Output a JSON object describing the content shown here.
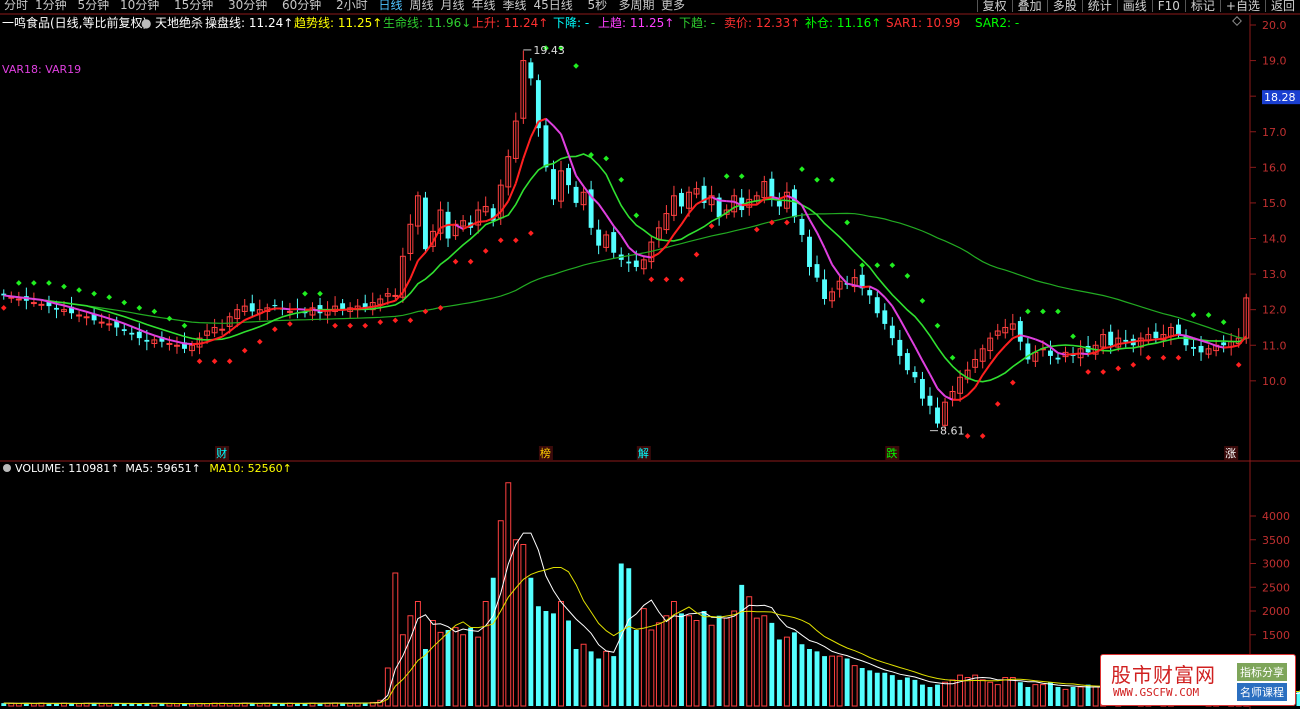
{
  "toolbar": {
    "tabs": [
      "分时",
      "1分钟",
      "5分钟",
      "10分钟",
      "15分钟",
      "30分钟",
      "60分钟",
      "2小时",
      "日线",
      "周线",
      "月线",
      "年线",
      "季线",
      "45日线",
      "5秒",
      "多周期",
      "更多"
    ],
    "active_tab": "日线",
    "right_buttons": [
      "复权",
      "叠加",
      "多股",
      "统计",
      "画线",
      "F10",
      "标记",
      "+自选",
      "返回"
    ]
  },
  "info": {
    "stock": "一鸣食品(日线,等比前复权)",
    "indicator_icon": "circle-chevron-icon",
    "indicator": "天地绝杀",
    "items": [
      {
        "label": "操盘线: ",
        "value": "11.24",
        "arrow": "↑",
        "color": "#ffffff"
      },
      {
        "label": "趋势线: ",
        "value": "11.25",
        "arrow": "↑",
        "color": "#ffff00"
      },
      {
        "label": "生命线: ",
        "value": "11.96",
        "arrow": "↓",
        "color": "#2ecc2e"
      },
      {
        "label": "上升: ",
        "value": "11.24",
        "arrow": "↑",
        "color": "#ff3030"
      },
      {
        "label": "下降: ",
        "value": "-",
        "arrow": "",
        "color": "#00ffff"
      },
      {
        "label": "上趋: ",
        "value": "11.25",
        "arrow": "↑",
        "color": "#ff40ff"
      },
      {
        "label": "下趋: ",
        "value": "-",
        "arrow": "",
        "color": "#2ecc2e"
      },
      {
        "label": "卖价: ",
        "value": "12.33",
        "arrow": "↑",
        "color": "#ff3030"
      },
      {
        "label": "补仓: ",
        "value": "11.16",
        "arrow": "↑",
        "color": "#00ff00"
      },
      {
        "label": "SAR1: ",
        "value": "10.99",
        "arrow": "",
        "color": "#ff3030"
      },
      {
        "label": "SAR2: ",
        "value": "-",
        "arrow": "",
        "color": "#00ff00"
      }
    ]
  },
  "var_label": "VAR18: VAR19",
  "volume_info": [
    {
      "label": "VOLUME: ",
      "value": "110981",
      "arrow": "↑",
      "color": "#ffffff"
    },
    {
      "label": "MA5: ",
      "value": "59651",
      "arrow": "↑",
      "color": "#ffffff"
    },
    {
      "label": "MA10: ",
      "value": "52560",
      "arrow": "↑",
      "color": "#ffff00"
    }
  ],
  "price_axis": {
    "min": 8.0,
    "max": 20.0,
    "ticks": [
      10.0,
      11.0,
      12.0,
      13.0,
      14.0,
      15.0,
      16.0,
      17.0,
      18.0,
      19.0,
      20.0
    ],
    "current": "18.28"
  },
  "volume_axis": {
    "ticks": [
      1500,
      2000,
      2500,
      3000,
      3500,
      4000
    ]
  },
  "annotations": {
    "high": "19.43",
    "low": "8.61"
  },
  "signal_labels": [
    {
      "text": "财",
      "index": 29,
      "color": "#00ffff"
    },
    {
      "text": "榜",
      "index": 72,
      "color": "#ffd000"
    },
    {
      "text": "解",
      "index": 85,
      "color": "#00ffff"
    },
    {
      "text": "跌",
      "index": 118,
      "color": "#00ff00"
    },
    {
      "text": "涨",
      "index": 163,
      "color": "#ffffff"
    }
  ],
  "logo": {
    "name": "股市财富网",
    "url": "WWW.GSCFW.COM",
    "tag1": "指标分享",
    "tag2": "名师课程"
  },
  "colors": {
    "up": "#ff4040",
    "down": "#54ffff",
    "ma_long": "#22aa22",
    "trend": "#ff2020",
    "support": "#e040e0",
    "life": "#30e030",
    "sar_up": "#ff2020",
    "sar_down": "#20ee20"
  },
  "chart_data": {
    "type": "candlestick",
    "title": "一鸣食品(日线,等比前复权)",
    "price_range": [
      8.0,
      20.0
    ],
    "close": [
      12.4,
      12.35,
      12.3,
      12.25,
      12.2,
      12.15,
      12.1,
      12.0,
      12.0,
      11.9,
      11.85,
      11.8,
      11.7,
      11.65,
      11.6,
      11.5,
      11.4,
      11.3,
      11.2,
      11.1,
      11.15,
      11.1,
      11.05,
      11.0,
      10.9,
      11.0,
      11.2,
      11.4,
      11.5,
      11.45,
      11.8,
      12.0,
      12.1,
      11.95,
      12.0,
      12.05,
      12.1,
      12.0,
      11.95,
      12.0,
      11.9,
      12.05,
      11.9,
      12.0,
      12.1,
      12.0,
      12.05,
      12.1,
      12.05,
      12.2,
      12.3,
      12.45,
      12.4,
      13.5,
      14.4,
      15.2,
      13.7,
      14.2,
      14.8,
      14.0,
      14.4,
      14.5,
      14.3,
      14.8,
      14.9,
      14.5,
      15.5,
      16.3,
      17.3,
      19.0,
      18.5,
      17.1,
      16.0,
      15.1,
      15.9,
      15.5,
      15.0,
      15.3,
      14.3,
      13.8,
      14.1,
      13.6,
      13.4,
      13.3,
      13.2,
      13.4,
      13.9,
      14.3,
      14.7,
      15.2,
      14.9,
      15.3,
      15.4,
      15.0,
      15.2,
      14.6,
      14.8,
      15.2,
      14.8,
      15.1,
      15.2,
      15.6,
      15.1,
      14.9,
      15.3,
      14.6,
      14.1,
      13.2,
      12.9,
      12.3,
      12.5,
      12.8,
      12.7,
      12.9,
      12.6,
      12.4,
      11.9,
      11.6,
      11.2,
      10.7,
      10.3,
      10.1,
      9.5,
      9.3,
      8.8,
      9.4,
      9.7,
      10.1,
      10.3,
      10.6,
      10.9,
      11.2,
      11.4,
      11.5,
      11.6,
      11.1,
      10.6,
      10.8,
      10.9,
      10.7,
      10.6,
      10.8,
      10.7,
      10.9,
      10.8,
      11.0,
      11.3,
      11.0,
      11.2,
      11.1,
      11.0,
      11.2,
      11.3,
      11.2,
      11.3,
      11.5,
      11.3,
      11.0,
      10.9,
      10.8,
      10.9,
      11.0,
      11.0,
      11.1,
      11.2,
      12.33
    ],
    "volume": [
      60,
      55,
      52,
      58,
      50,
      62,
      48,
      55,
      60,
      52,
      50,
      58,
      60,
      55,
      53,
      50,
      48,
      52,
      55,
      60,
      58,
      52,
      50,
      48,
      46,
      50,
      55,
      52,
      60,
      58,
      52,
      56,
      60,
      55,
      52,
      58,
      50,
      55,
      60,
      52,
      58,
      62,
      55,
      60,
      65,
      58,
      60,
      62,
      70,
      75,
      120,
      800,
      2800,
      1500,
      1900,
      2200,
      1200,
      1800,
      1550,
      1600,
      1650,
      1500,
      1650,
      1450,
      2200,
      2700,
      3900,
      4700,
      3500,
      3400,
      2700,
      2100,
      2000,
      1950,
      2200,
      1800,
      1200,
      1300,
      1150,
      1000,
      1150,
      1050,
      3000,
      2900,
      1600,
      2050,
      1600,
      1750,
      1900,
      2200,
      1950,
      1900,
      1800,
      2000,
      1700,
      1900,
      1850,
      2000,
      2550,
      2300,
      1850,
      1900,
      1750,
      1400,
      1450,
      1550,
      1300,
      1200,
      1150,
      1050,
      1050,
      1050,
      1000,
      850,
      800,
      750,
      700,
      700,
      650,
      550,
      600,
      550,
      450,
      400,
      450,
      500,
      550,
      650,
      600,
      650,
      550,
      500,
      450,
      600,
      600,
      500,
      400,
      450,
      450,
      500,
      400,
      350,
      400,
      400,
      450,
      400,
      350,
      450,
      850,
      450,
      400,
      350,
      300,
      350,
      300,
      350,
      300,
      280,
      300,
      350,
      450,
      500,
      300,
      350,
      400,
      350,
      300,
      350,
      200,
      250,
      300,
      250,
      300,
      1109.81
    ],
    "volume_ma5": [
      59651
    ],
    "volume_ma10": [
      52560
    ],
    "lines": {
      "操盘线": 11.24,
      "趋势线": 11.25,
      "生命线": 11.96,
      "卖价": 12.33,
      "补仓": 11.16,
      "SAR1": 10.99
    },
    "high_marker": 19.43,
    "low_marker": 8.61
  }
}
